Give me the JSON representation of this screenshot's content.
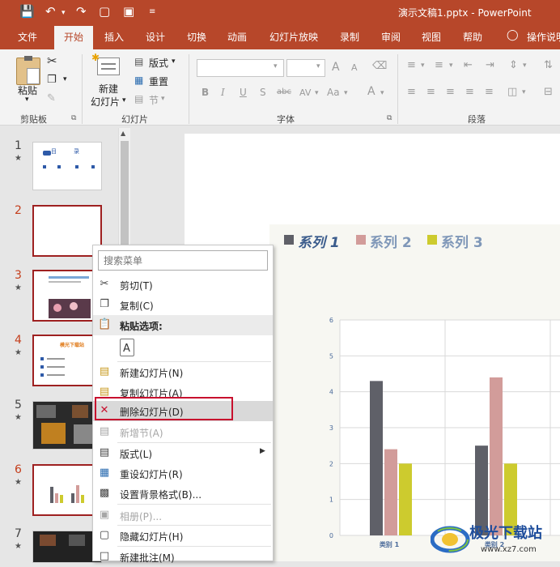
{
  "window": {
    "title": "演示文稿1.pptx  -  PowerPoint"
  },
  "quick_access": {
    "icons": [
      "save-icon",
      "undo-icon",
      "redo-icon",
      "present-from-start-icon",
      "print-preview-icon",
      "customize-dropdown-icon"
    ]
  },
  "tabs": [
    "文件",
    "开始",
    "插入",
    "设计",
    "切换",
    "动画",
    "幻灯片放映",
    "录制",
    "审阅",
    "视图",
    "帮助",
    "操作说明"
  ],
  "active_tab": "开始",
  "ribbon": {
    "clipboard": {
      "paste": "粘贴",
      "label": "剪贴板"
    },
    "slides": {
      "new_slide_line1": "新建",
      "new_slide_line2": "幻灯片",
      "layout": "版式",
      "reset": "重置",
      "section": "节",
      "label": "幻灯片"
    },
    "font": {
      "label": "字体",
      "bold": "B",
      "italic": "I",
      "underline": "U",
      "shadow": "S",
      "strike": "abc",
      "spacing": "AV",
      "case": "Aa",
      "grow": "A",
      "shrink": "A",
      "color": "A"
    },
    "paragraph": {
      "label": "段落"
    }
  },
  "slides": [
    {
      "num": "1",
      "star": "★"
    },
    {
      "num": "2",
      "star": ""
    },
    {
      "num": "3",
      "star": "★"
    },
    {
      "num": "4",
      "star": "★"
    },
    {
      "num": "5",
      "star": "★"
    },
    {
      "num": "6",
      "star": "★"
    },
    {
      "num": "7",
      "star": "★"
    }
  ],
  "thumb_texts": {
    "s1_a": "目",
    "s1_b": "录",
    "s4_title": "模光下载站"
  },
  "context_menu": {
    "search_placeholder": "搜索菜单",
    "items": [
      {
        "label": "剪切(T)",
        "icon": "scissors-icon",
        "disabled": false
      },
      {
        "label": "复制(C)",
        "icon": "copy-icon",
        "disabled": false
      },
      {
        "label": "粘贴选项:",
        "icon": "paste-icon",
        "disabled": false
      },
      {
        "label": "",
        "icon": "paste-keep-text-icon",
        "disabled": false
      },
      {
        "label": "新建幻灯片(N)",
        "icon": "new-slide-icon",
        "disabled": false
      },
      {
        "label": "复制幻灯片(A)",
        "icon": "duplicate-slide-icon",
        "disabled": false
      },
      {
        "label": "删除幻灯片(D)",
        "icon": "delete-slide-icon",
        "disabled": false
      },
      {
        "label": "新增节(A)",
        "icon": "add-section-icon",
        "disabled": true
      },
      {
        "label": "版式(L)",
        "icon": "layout-icon",
        "disabled": false
      },
      {
        "label": "重设幻灯片(R)",
        "icon": "reset-slide-icon",
        "disabled": false
      },
      {
        "label": "设置背景格式(B)...",
        "icon": "format-background-icon",
        "disabled": false
      },
      {
        "label": "相册(P)...",
        "icon": "photo-album-icon",
        "disabled": true
      },
      {
        "label": "隐藏幻灯片(H)",
        "icon": "hide-slide-icon",
        "disabled": false
      },
      {
        "label": "新建批注(M)",
        "icon": "new-comment-icon",
        "disabled": false
      }
    ]
  },
  "chart_data": {
    "type": "bar",
    "categories": [
      "类别 1",
      "类别 2"
    ],
    "series": [
      {
        "name": "系列 1",
        "values": [
          4.3,
          2.5
        ],
        "color": "#5f6068"
      },
      {
        "name": "系列 2",
        "values": [
          2.4,
          4.4
        ],
        "color": "#d29c9a"
      },
      {
        "name": "系列 3",
        "values": [
          2.0,
          2.0
        ],
        "color": "#cdcb2e"
      }
    ],
    "y_ticks": [
      "0",
      "1",
      "2",
      "3",
      "4",
      "5",
      "6"
    ],
    "ylim": [
      0,
      6
    ],
    "grid": true,
    "legend": "top"
  },
  "watermark": {
    "text": "极光下载站",
    "url": "www.xz7.com"
  }
}
